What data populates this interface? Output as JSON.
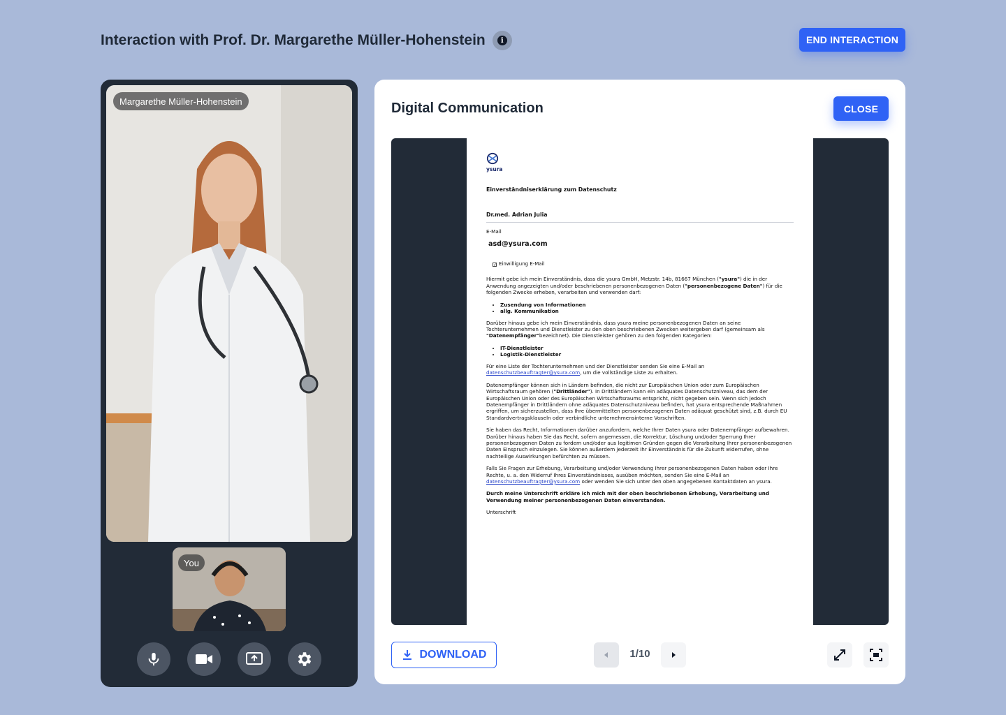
{
  "header": {
    "title": "Interaction with Prof. Dr. Margarethe Müller-Hohenstein",
    "info_icon": "info-icon",
    "end_button": "END INTERACTION"
  },
  "video": {
    "remote_name": "Margarethe Müller-Hohenstein",
    "self_label": "You",
    "controls": [
      "microphone-icon",
      "camera-icon",
      "screen-share-icon",
      "settings-icon"
    ]
  },
  "document_panel": {
    "title": "Digital Communication",
    "close_button": "CLOSE",
    "download_button": "DOWNLOAD",
    "page_counter": "1/10",
    "page": {
      "logo_text": "ysura",
      "heading": "Einverständniserklärung zum Datenschutz",
      "name": "Dr.med. Adrian Julia",
      "email_label": "E-Mail",
      "email_value": "asd@ysura.com",
      "checkbox_label": "Einwilligung E-Mail",
      "para1_a": "Hiermit gebe ich mein Einverständnis, dass die ysura GmbH, Metzstr. 14b, 81667 München (",
      "para1_b": "\"ysura\"",
      "para1_c": ") die in der Anwendung angezeigten und/oder beschriebenen personenbezogenen Daten (",
      "para1_d": "\"personenbezogene Daten\"",
      "para1_e": ") für die folgenden Zwecke erheben, verarbeiten und verwenden darf:",
      "list1": [
        "Zusendung von Informationen",
        "allg. Kommunikation"
      ],
      "para2_a": "Darüber hinaus gebe ich mein Einverständnis, dass ysura meine personenbezogenen Daten an seine Tochterunternehmen und Dienstleister zu den oben beschriebenen Zwecken weitergeben darf (gemeinsam als ",
      "para2_b": "\"Datenempfänger\"",
      "para2_c": "bezeichnet). Die Dienstleister gehören zu den folgenden Kategorien:",
      "list2": [
        "IT-Dienstleister",
        "Logistik-Dienstleister"
      ],
      "para3_a": "Für eine Liste der Tochterunternehmen und der Dienstleister senden Sie eine E-Mail an ",
      "para3_link": "datenschutzbeauftragter@ysura.com",
      "para3_b": ", um die vollständige Liste zu erhalten.",
      "para4_a": "Datenempfänger können sich in Ländern befinden, die nicht zur Europäischen Union oder zum Europäischen Wirtschaftsraum gehören (",
      "para4_b": "\"Drittländer\"",
      "para4_c": "). In Drittländern kann ein adäquates Datenschutzniveau, das dem der Europäischen Union oder des Europäischen Wirtschaftsraums entspricht, nicht gegeben sein. Wenn sich jedoch Datenempfänger in Drittländern ohne adäquates Datenschutzniveau befinden, hat ysura entsprechende Maßnahmen ergriffen, um sicherzustellen, dass Ihre übermittelten personenbezogenen Daten adäquat geschützt sind, z.B. durch EU Standardvertragsklauseln oder verbindliche unternehmensinterne Vorschriften.",
      "para5": "Sie haben das Recht, Informationen darüber anzufordern, welche Ihrer Daten ysura oder Datenempfänger aufbewahren. Darüber hinaus haben Sie das Recht, sofern angemessen, die Korrektur, Löschung und/oder Sperrung Ihrer personenbezogenen Daten zu fordern und/oder aus legitimen Gründen gegen die Verarbeitung Ihrer personenbezogenen Daten Einspruch einzulegen. Sie können außerdem jederzeit Ihr Einverständnis für die Zukunft widerrufen, ohne nachteilige Auswirkungen befürchten zu müssen.",
      "para6_a": "Falls Sie Fragen zur Erhebung, Verarbeitung und/oder Verwendung Ihrer personenbezogenen Daten haben oder Ihre Rechte, u. a. den Widerruf Ihres Einverständnisses, ausüben möchten, senden Sie eine E-Mail an ",
      "para6_link": "datenschutzbeauftragter@ysura.com",
      "para6_b": " oder wenden Sie sich unter den oben angegebenen Kontaktdaten an ysura.",
      "para7": "Durch meine Unterschrift erkläre ich mich mit der oben beschriebenen Erhebung, Verarbeitung und Verwendung meiner personenbezogenen Daten einverstanden.",
      "signature_label": "Unterschrift"
    }
  },
  "colors": {
    "background": "#a9b9d9",
    "panel_dark": "#222b37",
    "accent": "#2f62f5"
  }
}
